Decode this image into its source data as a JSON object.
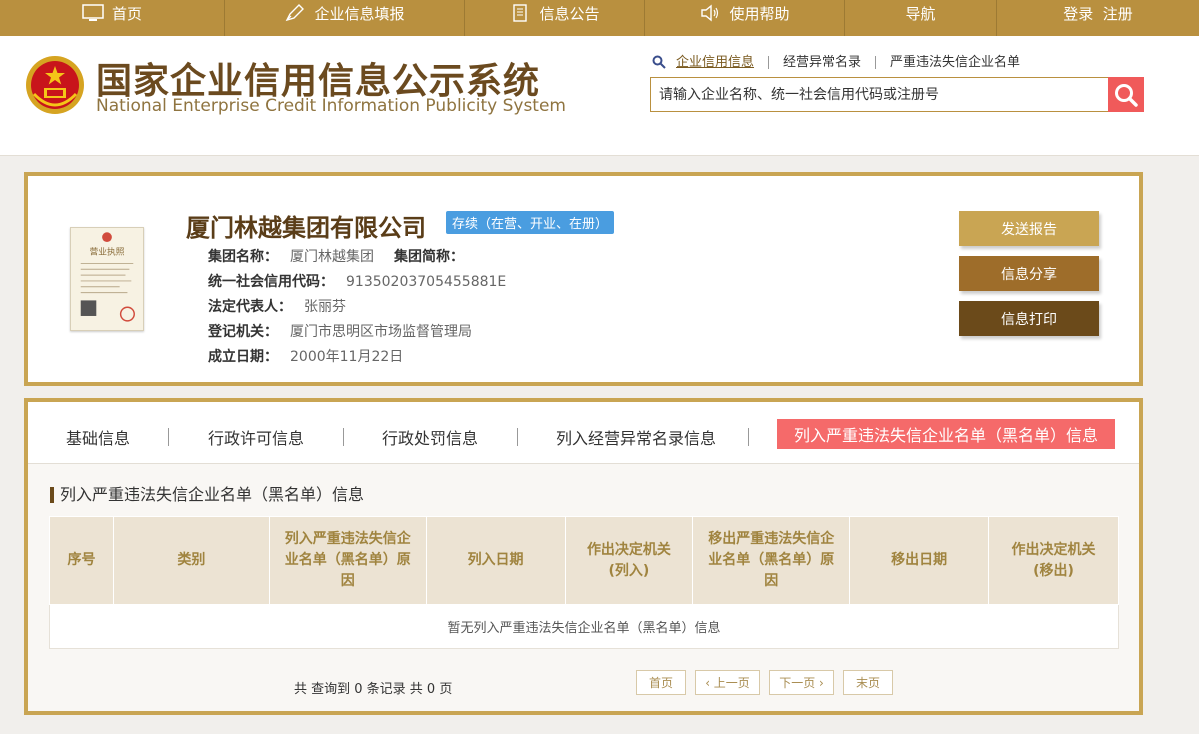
{
  "nav": {
    "items": [
      {
        "label": "首页",
        "icon": "monitor-icon"
      },
      {
        "label": "企业信息填报",
        "icon": "pen-icon"
      },
      {
        "label": "信息公告",
        "icon": "document-icon"
      },
      {
        "label": "使用帮助",
        "icon": "speaker-icon"
      },
      {
        "label": "导航",
        "icon": ""
      },
      {
        "label": "登录  注册",
        "icon": ""
      }
    ]
  },
  "header": {
    "title_cn": "国家企业信用信息公示系统",
    "title_en": "National Enterprise Credit Information Publicity System",
    "search_tabs": [
      "企业信用信息",
      "经营异常名录",
      "严重违法失信企业名单"
    ],
    "search_placeholder": "请输入企业名称、统一社会信用代码或注册号"
  },
  "company": {
    "name": "厦门林越集团有限公司",
    "status": "存续（在营、开业、在册）",
    "fields": {
      "group_name_label": "集团名称：",
      "group_name_value": "厦门林越集团",
      "group_short_label": "集团简称：",
      "credit_code_label": "统一社会信用代码：",
      "credit_code_value": "91350203705455881E",
      "legal_rep_label": "法定代表人：",
      "legal_rep_value": "张丽芬",
      "authority_label": "登记机关：",
      "authority_value": "厦门市思明区市场监督管理局",
      "founded_label": "成立日期：",
      "founded_value": "2000年11月22日"
    },
    "actions": {
      "send": "发送报告",
      "share": "信息分享",
      "print": "信息打印"
    }
  },
  "tabs": {
    "items": [
      "基础信息",
      "行政许可信息",
      "行政处罚信息",
      "列入经营异常名录信息"
    ],
    "active": "列入严重违法失信企业名单（黑名单）信息"
  },
  "section": {
    "title": "列入严重违法失信企业名单（黑名单）信息",
    "columns": [
      "序号",
      "类别",
      "列入严重违法失信企业名单（黑名单）原因",
      "列入日期",
      "作出决定机关(列入)",
      "移出严重违法失信企业名单（黑名单）原因",
      "移出日期",
      "作出决定机关(移出)"
    ],
    "empty_text": "暂无列入严重违法失信企业名单（黑名单）信息",
    "summary": "共 查询到 0 条记录 共 0 页",
    "pager": {
      "first": "首页",
      "prev": "‹ 上一页",
      "next": "下一页 ›",
      "last": "末页"
    }
  },
  "colors": {
    "nav_bg": "#b9903f",
    "border_gold": "#c9a553",
    "active_tab": "#f56a6a",
    "status_badge": "#4a9de0"
  }
}
